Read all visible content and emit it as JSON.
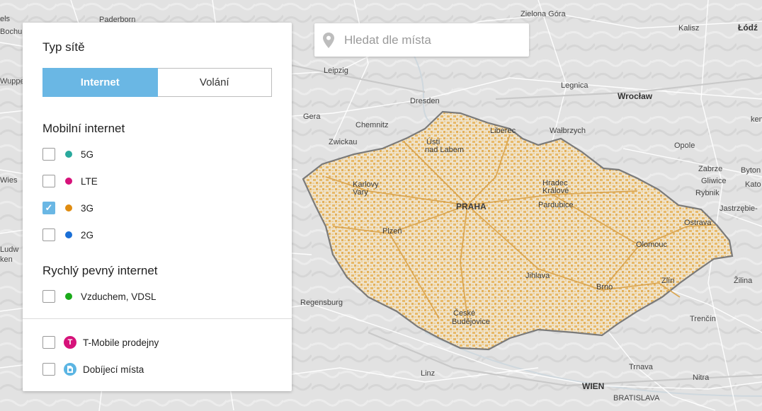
{
  "search": {
    "placeholder": "Hledat dle místa"
  },
  "panel": {
    "network_type_title": "Typ sítě",
    "tabs": [
      {
        "label": "Internet",
        "active": true
      },
      {
        "label": "Volání",
        "active": false
      }
    ],
    "mobile_title": "Mobilní internet",
    "mobile_items": [
      {
        "label": "5G",
        "checked": false,
        "color": "#29a99d"
      },
      {
        "label": "LTE",
        "checked": false,
        "color": "#d6127a"
      },
      {
        "label": "3G",
        "checked": true,
        "color": "#e08c10"
      },
      {
        "label": "2G",
        "checked": false,
        "color": "#1a6fd6"
      }
    ],
    "fixed_title": "Rychlý pevný internet",
    "fixed_items": [
      {
        "label": "Vzduchem, VDSL",
        "checked": false,
        "color": "#1aaa1a"
      }
    ],
    "poi_items": [
      {
        "label": "T-Mobile prodejny",
        "checked": false,
        "icon": "t-mobile-logo-icon",
        "color": "#d6127a"
      },
      {
        "label": "Dobíjecí místa",
        "checked": false,
        "icon": "sim-card-icon",
        "color": "#5bb5e3"
      }
    ]
  },
  "map": {
    "coverage_color": "#e8b968",
    "cities": {
      "paderborn": "Paderborn",
      "zielona_gora": "Zielona Góra",
      "kalisz": "Kalisz",
      "lodz": "Łódź",
      "bochum": "Bochu",
      "wuppertal": "Wuppe",
      "leipzig": "Leipzig",
      "legnica": "Legnica",
      "wroclaw": "Wrocław",
      "dresden": "Dresden",
      "gera": "Gera",
      "chemnitz": "Chemnitz",
      "liberec": "Liberec",
      "walbrzych": "Wałbrzych",
      "zwickau": "Zwickau",
      "usti1": "Ústí",
      "usti2": "nad Labem",
      "opole": "Opole",
      "zabrze": "Zabrze",
      "bytom": "Byton",
      "gliwice": "Gliwice",
      "katowice": "Kato",
      "rybnik": "Rybnik",
      "jastrzebie": "Jastrzębie-",
      "wies": "Wies",
      "karlovy1": "Karlovy",
      "karlovy2": "Vary",
      "hradec1": "Hradec",
      "hradec2": "Králové",
      "praha": "PRAHA",
      "pardubice": "Pardubice",
      "ostrava": "Ostrava",
      "plzen": "Plzeň",
      "olomouc": "Olomouc",
      "jihlava": "Jihlava",
      "brno": "Brno",
      "zlin": "Zlín",
      "zilina": "Žilina",
      "regensburg": "Regensburg",
      "ceske1": "České",
      "ceske2": "Budějovice",
      "trencin": "Trenčín",
      "linz": "Linz",
      "trnava": "Trnava",
      "wien": "WIEN",
      "bratislava": "BRATISLAVA",
      "nitra": "Nitra",
      "ludwig": "Ludw",
      "ken": "ken",
      "els": "els"
    }
  }
}
